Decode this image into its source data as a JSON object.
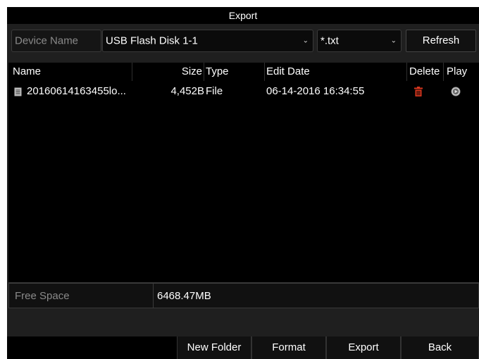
{
  "dialog": {
    "title": "Export"
  },
  "device": {
    "label": "Device Name",
    "value": "USB Flash Disk 1-1",
    "filter": "*.txt",
    "refresh_label": "Refresh"
  },
  "table": {
    "headers": {
      "name": "Name",
      "size": "Size",
      "type": "Type",
      "date": "Edit Date",
      "delete": "Delete",
      "play": "Play"
    },
    "rows": [
      {
        "name": "20160614163455lo...",
        "size": "4,452B",
        "type": "File",
        "date": "06-14-2016 16:34:55",
        "delete_icon": "trash-icon",
        "play_icon": "play-circle-icon"
      }
    ]
  },
  "free_space": {
    "label": "Free Space",
    "value": "6468.47MB"
  },
  "buttons": {
    "new_folder": "New Folder",
    "format": "Format",
    "export": "Export",
    "back": "Back"
  },
  "colors": {
    "delete_icon": "#d9361e",
    "background": "#1f1f1f"
  }
}
